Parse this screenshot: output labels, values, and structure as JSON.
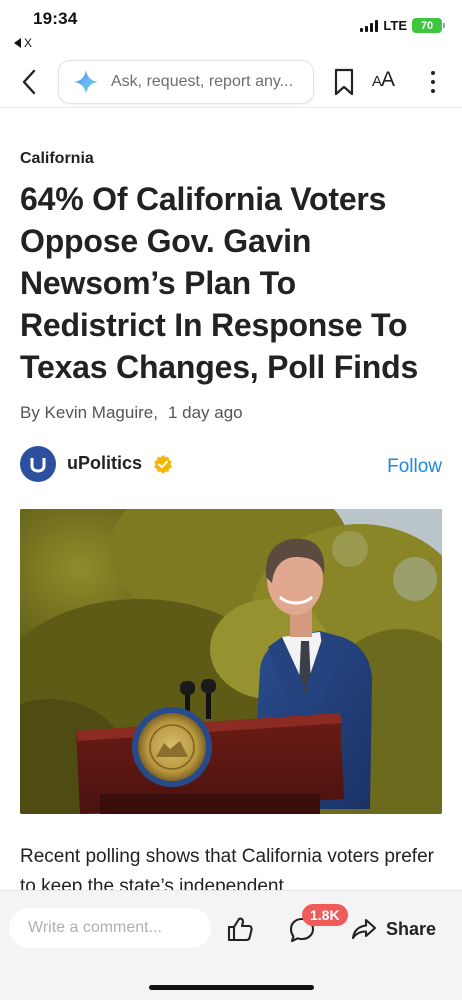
{
  "status_bar": {
    "time": "19:34",
    "back_app": "X",
    "network": "LTE",
    "battery": "70"
  },
  "toolbar": {
    "search_placeholder": "Ask, request, report any..."
  },
  "article": {
    "category": "California",
    "headline": "64% Of California Voters Oppose Gov. Gavin Newsom’s Plan To Redistrict In Response To Texas Changes, Poll Finds",
    "byline": "By Kevin Maguire,",
    "published": "1 day ago",
    "source_name": "uPolitics",
    "follow_label": "Follow",
    "body_snippet": "Recent polling shows that California voters prefer to keep the state’s independent"
  },
  "bottom_bar": {
    "comment_placeholder": "Write a comment...",
    "comment_count": "1.8K",
    "share_label": "Share"
  },
  "colors": {
    "accent": "#1e88e5",
    "badge": "#ef5a5a",
    "source_logo": "#2d4fa0",
    "verified": "#f2b705"
  }
}
